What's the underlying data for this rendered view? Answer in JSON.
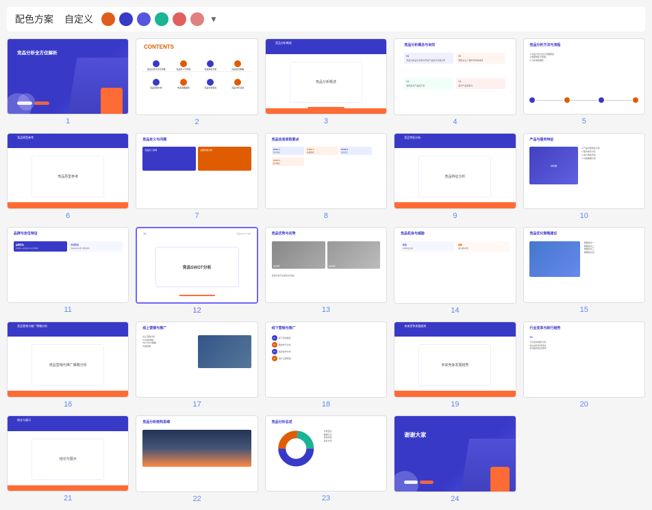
{
  "topbar": {
    "color_scheme_label": "配色方案",
    "custom_label": "自定义",
    "colors": [
      {
        "value": "#e05c1c",
        "name": "orange"
      },
      {
        "value": "#3939c8",
        "name": "blue"
      },
      {
        "value": "#5555e0",
        "name": "purple"
      },
      {
        "value": "#1ab394",
        "name": "green"
      },
      {
        "value": "#e06060",
        "name": "red"
      },
      {
        "value": "#e08080",
        "name": "pink"
      }
    ]
  },
  "slides": [
    {
      "number": "1",
      "title": "竞品分析全方位解析",
      "type": "cover"
    },
    {
      "number": "2",
      "title": "CONTENTS",
      "type": "contents"
    },
    {
      "number": "3",
      "title": "竞品分析概述",
      "type": "section"
    },
    {
      "number": "4",
      "title": "竞品分析概念与目的",
      "type": "text"
    },
    {
      "number": "5",
      "title": "竞品分析方法与流程",
      "type": "diagram"
    },
    {
      "number": "6",
      "title": "竞品原型参考",
      "type": "center"
    },
    {
      "number": "7",
      "title": "竞品定义与问题",
      "type": "two-col"
    },
    {
      "number": "8",
      "title": "竞品信息获取要点",
      "type": "table"
    },
    {
      "number": "9",
      "title": "竞品特征分析",
      "type": "center"
    },
    {
      "number": "10",
      "title": "产品与服务特征",
      "type": "list"
    },
    {
      "number": "11",
      "title": "品牌与定位特征",
      "type": "text2"
    },
    {
      "number": "12",
      "title": "竞品SWOT分析",
      "type": "selected"
    },
    {
      "number": "13",
      "title": "竞品优势与劣势",
      "type": "photos"
    },
    {
      "number": "14",
      "title": "竞品机会与威胁",
      "type": "two-col2"
    },
    {
      "number": "15",
      "title": "竞品优化策略建议",
      "type": "photo-left"
    },
    {
      "number": "16",
      "title": "竞品营销与推广策略分析",
      "type": "center2"
    },
    {
      "number": "17",
      "title": "线上营销与推广",
      "type": "photo-right"
    },
    {
      "number": "18",
      "title": "线下营销与推广",
      "type": "numbered"
    },
    {
      "number": "19",
      "title": "未来竞争发展趋势",
      "type": "center3"
    },
    {
      "number": "20",
      "title": "行业变革与新行趋势",
      "type": "small-title"
    },
    {
      "number": "21",
      "title": "结论与展示",
      "type": "center4"
    },
    {
      "number": "22",
      "title": "竞品分析结构思维",
      "type": "photo-bg"
    },
    {
      "number": "23",
      "title": "竞品分析总述",
      "type": "chart"
    },
    {
      "number": "24",
      "title": "谢谢大家",
      "type": "end"
    }
  ]
}
